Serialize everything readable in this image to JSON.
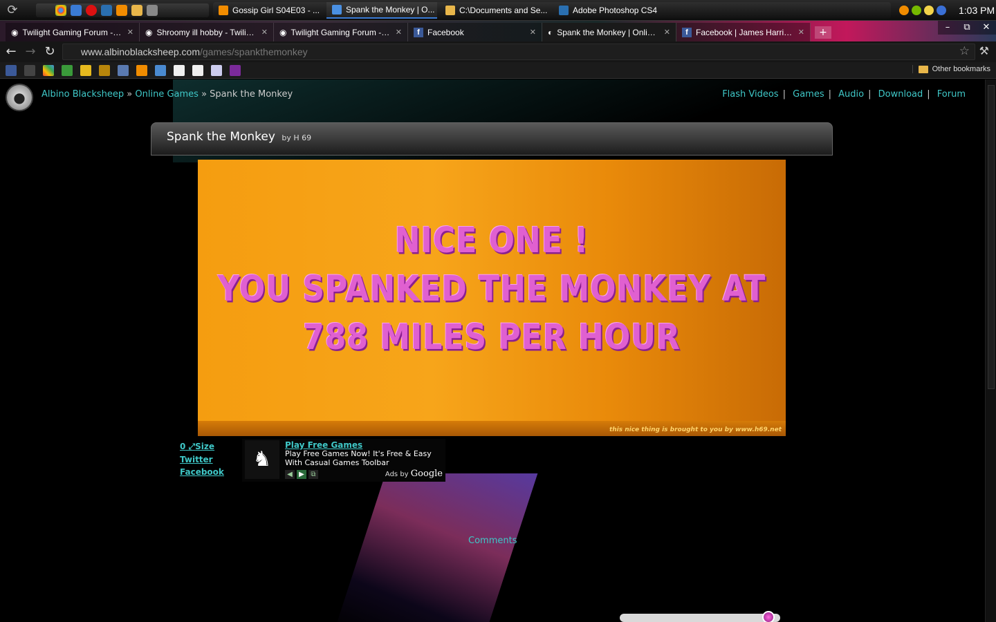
{
  "taskbar": {
    "quicklaunch": [
      "chrome-icon",
      "ie-icon",
      "opera-icon",
      "photoshop-icon",
      "vlc-icon",
      "folder-icon",
      "app-icon"
    ],
    "tasks": [
      {
        "label": "Gossip Girl S04E03 - ...",
        "icon": "vlc-icon",
        "color": "#f28c00"
      },
      {
        "label": "Spank the Monkey | O...",
        "icon": "chrome-icon",
        "color": "#4a90e2",
        "active": true
      },
      {
        "label": "C:\\Documents and Se...",
        "icon": "folder-icon",
        "color": "#e8b64a"
      },
      {
        "label": "Adobe Photoshop CS4",
        "icon": "photoshop-icon",
        "color": "#2a6fb0"
      }
    ],
    "clock": "1:03 PM"
  },
  "browser": {
    "tabs": [
      {
        "label": "Twilight Gaming Forum -> C...",
        "icon": "eye-icon"
      },
      {
        "label": "Shroomy ill hobby - Twilight...",
        "icon": "eye-icon"
      },
      {
        "label": "Twilight Gaming Forum -> C...",
        "icon": "eye-icon"
      },
      {
        "label": "Facebook",
        "icon": "facebook-icon"
      },
      {
        "label": "Spank the Monkey | Online ...",
        "icon": "albino-icon",
        "active": true
      },
      {
        "label": "Facebook | James Harris's ...",
        "icon": "facebook-icon"
      }
    ],
    "url_host": "www.albinoblacksheep.com",
    "url_path": "/games/spankthemonkey",
    "other_bookmarks": "Other bookmarks"
  },
  "site": {
    "breadcrumb": {
      "home": "Albino Blacksheep",
      "section": "Online Games",
      "current": "Spank the Monkey"
    },
    "nav": [
      "Flash Videos",
      "Games",
      "Audio",
      "Download",
      "Forum"
    ],
    "game_title": "Spank the Monkey",
    "game_author": "by H 69",
    "game_lines": [
      "NICE ONE !",
      "YOU SPANKED THE MONKEY AT",
      "788 MILES PER HOUR"
    ],
    "game_credit": "this nice thing is brought to you by www.h69.net",
    "side_links": {
      "size_count": "0",
      "size": "Size",
      "twitter": "Twitter",
      "facebook": "Facebook"
    },
    "ad": {
      "title": "Play Free Games",
      "text": "Play Free Games Now! It's Free & Easy With Casual Games Toolbar",
      "ads_by": "Ads by",
      "google": "Google"
    },
    "comments": "Comments"
  },
  "colors": {
    "link": "#3fc7c7",
    "game_bg": "#f59d10",
    "game_text": "#e060d0"
  }
}
